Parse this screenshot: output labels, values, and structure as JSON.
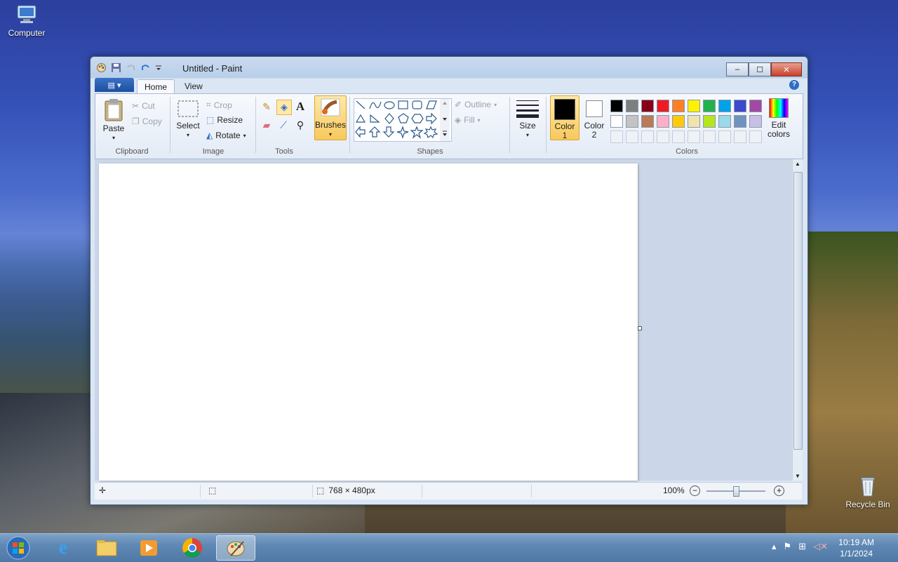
{
  "desktop": {
    "icons": [
      {
        "label": "Computer"
      },
      {
        "label": "Recycle Bin"
      }
    ]
  },
  "window": {
    "title": "Untitled - Paint",
    "buttons": {
      "minimize": "–",
      "maximize": "☐",
      "close": "✕"
    }
  },
  "ribbon": {
    "file_button": "▤ ▾",
    "tabs": [
      {
        "label": "Home",
        "active": true
      },
      {
        "label": "View",
        "active": false
      }
    ],
    "help": "?",
    "clipboard": {
      "paste": "Paste",
      "cut": "Cut",
      "copy": "Copy",
      "group": "Clipboard"
    },
    "image": {
      "select": "Select",
      "crop": "Crop",
      "resize": "Resize",
      "rotate": "Rotate",
      "group": "Image"
    },
    "tools": {
      "group": "Tools"
    },
    "brushes": {
      "label": "Brushes"
    },
    "shapes": {
      "outline": "Outline",
      "fill": "Fill",
      "group": "Shapes"
    },
    "size": {
      "label": "Size"
    },
    "color1": {
      "label": "Color",
      "sub": "1",
      "value": "#000000"
    },
    "color2": {
      "label": "Color",
      "sub": "2",
      "value": "#ffffff"
    },
    "colors": {
      "group": "Colors",
      "edit_line1": "Edit",
      "edit_line2": "colors"
    },
    "palette": [
      "#000000",
      "#7f7f7f",
      "#880015",
      "#ed1c24",
      "#ff7f27",
      "#fff200",
      "#22b14c",
      "#00a2e8",
      "#3f48cc",
      "#a349a4",
      "#ffffff",
      "#c3c3c3",
      "#b97a57",
      "#ffaec9",
      "#ffc90e",
      "#efe4b0",
      "#b5e61d",
      "#99d9ea",
      "#7092be",
      "#c8bfe7"
    ]
  },
  "status": {
    "canvas_size": "768 × 480px",
    "zoom": "100%"
  },
  "taskbar": {
    "time": "10:19 AM",
    "date": "1/1/2024"
  }
}
